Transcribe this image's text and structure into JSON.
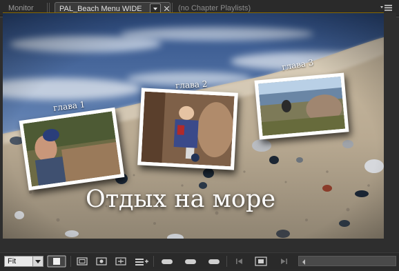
{
  "tabs": {
    "monitor": "Monitor",
    "active": "PAL_Beach Menu WIDE",
    "inactive": "(no Chapter Playlists)"
  },
  "icons": {
    "tab_dropdown": "chevron-down-icon",
    "tab_close": "close-icon",
    "panel_menu": "panel-menu-icon"
  },
  "menu": {
    "title": "Отдых на море",
    "chapters": [
      {
        "label": "глава 1"
      },
      {
        "label": "глава 2"
      },
      {
        "label": "глава 3"
      }
    ]
  },
  "toolbar": {
    "zoom_value": "Fit",
    "buttons": [
      "fit-view-icon",
      "safe-area-icon",
      "center-icon",
      "expand-icon",
      "list-icon",
      "add-icon",
      "button-shape-1-icon",
      "button-shape-2-icon",
      "button-shape-3-icon",
      "previous-icon",
      "frame-icon",
      "next-icon"
    ]
  },
  "colors": {
    "accent_tab_border": "#6a6a6a",
    "stage_outline": "#8a6a00"
  }
}
